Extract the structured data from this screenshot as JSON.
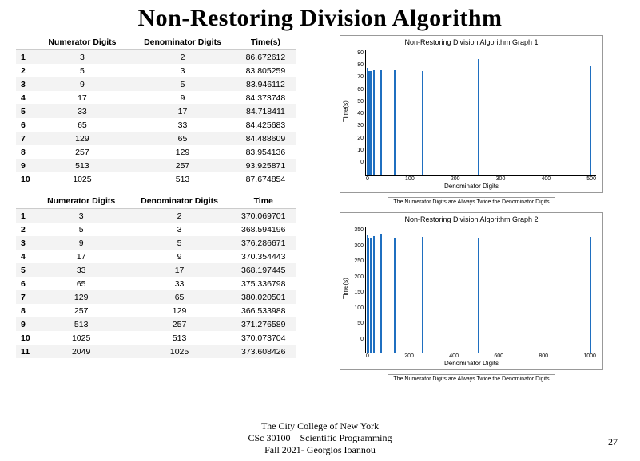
{
  "title": "Non-Restoring Division Algorithm",
  "table1": {
    "headers": [
      "",
      "Numerator Digits",
      "Denominator Digits",
      "Time(s)"
    ],
    "rows": [
      [
        "1",
        "3",
        "2",
        "86.672612"
      ],
      [
        "2",
        "5",
        "3",
        "83.805259"
      ],
      [
        "3",
        "9",
        "5",
        "83.946112"
      ],
      [
        "4",
        "17",
        "9",
        "84.373748"
      ],
      [
        "5",
        "33",
        "17",
        "84.718411"
      ],
      [
        "6",
        "65",
        "33",
        "84.425683"
      ],
      [
        "7",
        "129",
        "65",
        "84.488609"
      ],
      [
        "8",
        "257",
        "129",
        "83.954136"
      ],
      [
        "9",
        "513",
        "257",
        "93.925871"
      ],
      [
        "10",
        "1025",
        "513",
        "87.674854"
      ]
    ]
  },
  "table2": {
    "headers": [
      "",
      "Numerator Digits",
      "Denominator Digits",
      "Time"
    ],
    "rows": [
      [
        "1",
        "3",
        "2",
        "370.069701"
      ],
      [
        "2",
        "5",
        "3",
        "368.594196"
      ],
      [
        "3",
        "9",
        "5",
        "376.286671"
      ],
      [
        "4",
        "17",
        "9",
        "370.354443"
      ],
      [
        "5",
        "33",
        "17",
        "368.197445"
      ],
      [
        "6",
        "65",
        "33",
        "375.336798"
      ],
      [
        "7",
        "129",
        "65",
        "380.020501"
      ],
      [
        "8",
        "257",
        "129",
        "366.533988"
      ],
      [
        "9",
        "513",
        "257",
        "371.276589"
      ],
      [
        "10",
        "1025",
        "513",
        "370.073704"
      ],
      [
        "11",
        "2049",
        "1025",
        "373.608426"
      ]
    ]
  },
  "chart1": {
    "title": "Non-Restoring Division Algorithm Graph 1",
    "xlabel": "Denominator Digits",
    "ylabel": "Time(s)",
    "caption": "The Numerator Digits are Always Twice the Denominator Digits",
    "yticks": [
      "90",
      "80",
      "70",
      "60",
      "50",
      "40",
      "30",
      "20",
      "10",
      "0"
    ],
    "xticks": [
      "0",
      "100",
      "200",
      "300",
      "400",
      "500"
    ]
  },
  "chart2": {
    "title": "Non-Restoring Division Algorithm Graph 2",
    "xlabel": "Denominator Digits",
    "ylabel": "Time(s)",
    "caption": "The Numerator Digits are Always Twice the Denominator Digits",
    "yticks": [
      "350",
      "300",
      "250",
      "200",
      "150",
      "100",
      "50",
      "0"
    ],
    "xticks": [
      "0",
      "200",
      "400",
      "600",
      "800",
      "1000"
    ]
  },
  "chart_data": [
    {
      "type": "bar",
      "title": "Non-Restoring Division Algorithm Graph 1",
      "xlabel": "Denominator Digits",
      "ylabel": "Time(s)",
      "ylim": [
        0,
        95
      ],
      "xlim": [
        0,
        513
      ],
      "x": [
        2,
        3,
        5,
        9,
        17,
        33,
        65,
        129,
        257,
        513
      ],
      "values": [
        86.672612,
        83.805259,
        83.946112,
        84.373748,
        84.718411,
        84.425683,
        84.488609,
        83.954136,
        93.925871,
        87.674854
      ],
      "annotations": [
        "The Numerator Digits are Always Twice the Denominator Digits"
      ]
    },
    {
      "type": "bar",
      "title": "Non-Restoring Division Algorithm Graph 2",
      "xlabel": "Denominator Digits",
      "ylabel": "Time(s)",
      "ylim": [
        0,
        380
      ],
      "xlim": [
        0,
        1025
      ],
      "x": [
        2,
        3,
        5,
        9,
        17,
        33,
        65,
        129,
        257,
        513,
        1025
      ],
      "values": [
        370.069701,
        368.594196,
        376.286671,
        370.354443,
        368.197445,
        375.336798,
        380.020501,
        366.533988,
        371.276589,
        370.073704,
        373.608426
      ],
      "annotations": [
        "The Numerator Digits are Always Twice the Denominator Digits"
      ]
    }
  ],
  "footer": {
    "line1": "The City College of New York",
    "line2": "CSc 30100 – Scientific Programming",
    "line3": "Fall 2021- Georgios Ioannou"
  },
  "page_number": "27"
}
